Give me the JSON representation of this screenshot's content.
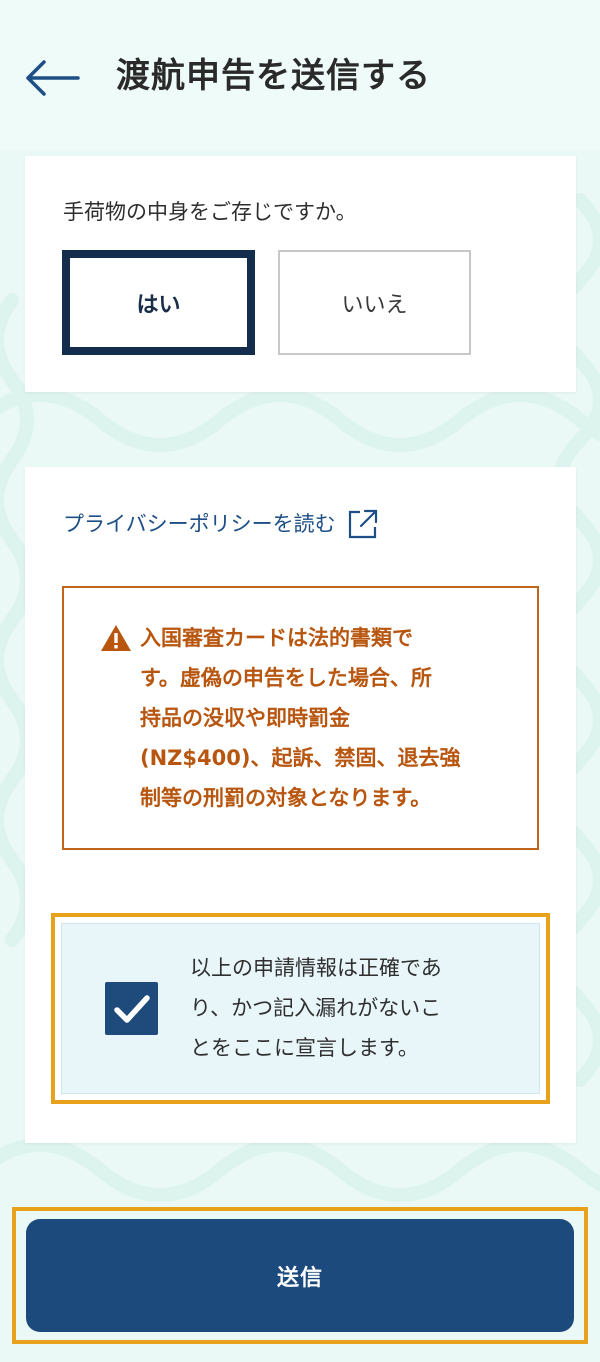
{
  "header": {
    "title": "渡航申告を送信する",
    "back_icon": "arrow-left-icon"
  },
  "luggage_question": {
    "question": "手荷物の中身をご存じですか。",
    "options": [
      {
        "label": "はい",
        "selected": true
      },
      {
        "label": "いいえ",
        "selected": false
      }
    ]
  },
  "privacy": {
    "link_text": "プライバシーポリシーを読む",
    "icon": "external-link-icon"
  },
  "warning": {
    "icon": "warning-triangle-icon",
    "lines": [
      "入国審査カードは法的書類で",
      "す。虚偽の申告をした場合、所",
      "持品の没収や即時罰金",
      "(NZ$400)、起訴、禁固、退去強",
      "制等の刑罰の対象となります。"
    ]
  },
  "declaration": {
    "checked": true,
    "lines": [
      "以上の申請情報は正確であ",
      "り、かつ記入漏れがないこ",
      "とをここに宣言します。"
    ]
  },
  "submit": {
    "label": "送信"
  },
  "colors": {
    "navy": "#142d4c",
    "primary": "#1c4a7d",
    "link": "#1d4f86",
    "warning": "#b8560f",
    "highlight": "#e8a11a",
    "background": "#eaf9f6"
  }
}
